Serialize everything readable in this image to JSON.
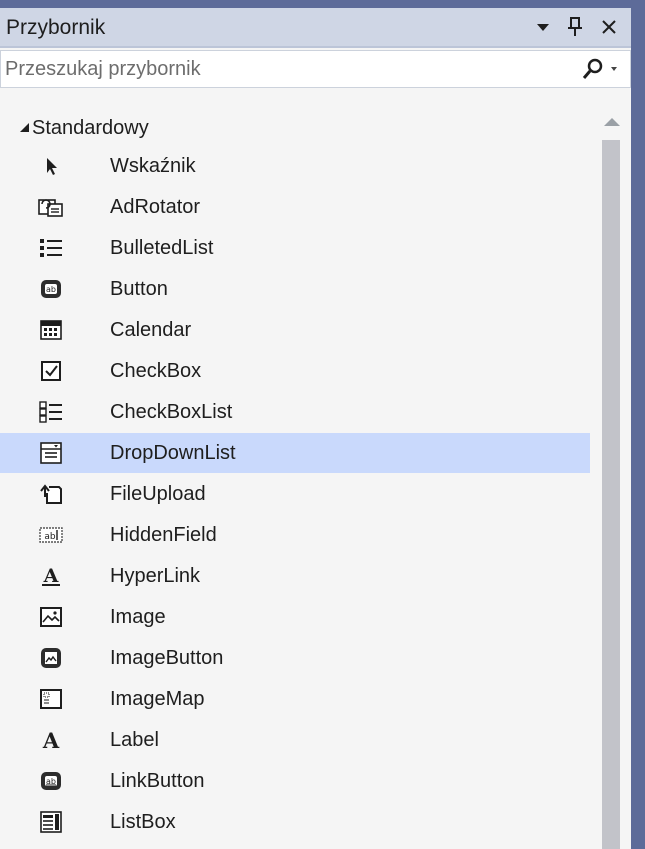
{
  "panel": {
    "title": "Przybornik",
    "dropdown_icon": "caret-down-icon",
    "pin_icon": "pin-icon",
    "close_icon": "close-icon"
  },
  "search": {
    "placeholder": "Przeszukaj przybornik",
    "icon": "search-icon"
  },
  "group": {
    "label": "Standardowy",
    "expanded": true
  },
  "items": [
    {
      "label": "Wskaźnik",
      "icon": "pointer-icon",
      "selected": false
    },
    {
      "label": "AdRotator",
      "icon": "adrotator-icon",
      "selected": false
    },
    {
      "label": "BulletedList",
      "icon": "bulleted-list-icon",
      "selected": false
    },
    {
      "label": "Button",
      "icon": "button-icon",
      "selected": false
    },
    {
      "label": "Calendar",
      "icon": "calendar-icon",
      "selected": false
    },
    {
      "label": "CheckBox",
      "icon": "checkbox-icon",
      "selected": false
    },
    {
      "label": "CheckBoxList",
      "icon": "checkbox-list-icon",
      "selected": false
    },
    {
      "label": "DropDownList",
      "icon": "dropdown-list-icon",
      "selected": true
    },
    {
      "label": "FileUpload",
      "icon": "file-upload-icon",
      "selected": false
    },
    {
      "label": "HiddenField",
      "icon": "hidden-field-icon",
      "selected": false
    },
    {
      "label": "HyperLink",
      "icon": "hyperlink-icon",
      "selected": false
    },
    {
      "label": "Image",
      "icon": "image-icon",
      "selected": false
    },
    {
      "label": "ImageButton",
      "icon": "image-button-icon",
      "selected": false
    },
    {
      "label": "ImageMap",
      "icon": "image-map-icon",
      "selected": false
    },
    {
      "label": "Label",
      "icon": "label-icon",
      "selected": false
    },
    {
      "label": "LinkButton",
      "icon": "link-button-icon",
      "selected": false
    },
    {
      "label": "ListBox",
      "icon": "listbox-icon",
      "selected": false
    }
  ],
  "colors": {
    "titlebar": "#cfd6e5",
    "selection": "#c9d9fc",
    "frame": "#5d6b99",
    "panel_bg": "#f5f5f5"
  }
}
